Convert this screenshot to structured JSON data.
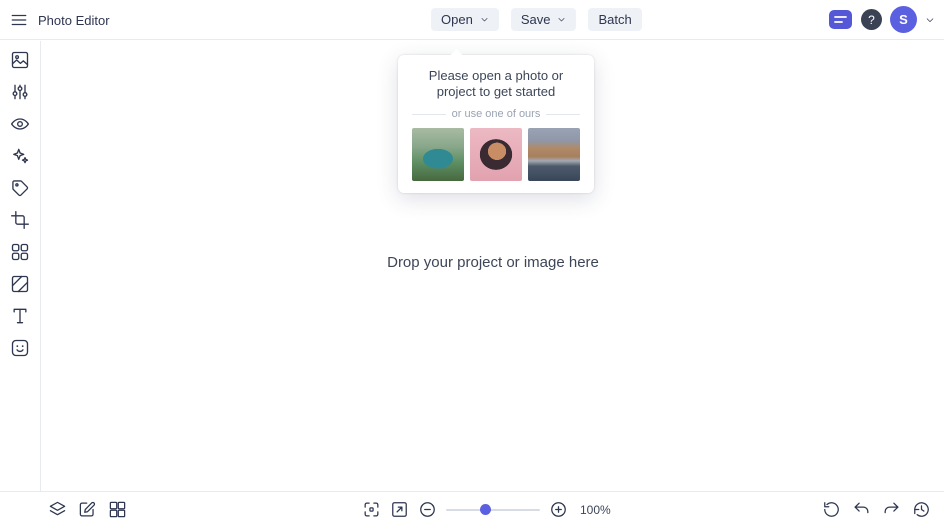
{
  "topbar": {
    "title": "Photo Editor",
    "open_label": "Open",
    "save_label": "Save",
    "batch_label": "Batch",
    "help_glyph": "?",
    "avatar_initial": "S"
  },
  "sidebar": {
    "tools": [
      "photo",
      "adjustments",
      "eye",
      "effects",
      "tag",
      "crop",
      "shapes",
      "overlay",
      "text",
      "sticker"
    ]
  },
  "popover": {
    "message": "Please open a photo or project to get started",
    "divider": "or use one of ours",
    "samples": [
      "van-sample",
      "portrait-sample",
      "canal-sample"
    ]
  },
  "canvas": {
    "drop_hint": "Drop your project or image here"
  },
  "bottombar": {
    "left_tools": [
      "layers",
      "edit-image",
      "collage-grid"
    ],
    "center_tools": [
      "fit-screen",
      "actual-size",
      "zoom-out",
      "zoom-slider",
      "zoom-in"
    ],
    "right_tools": [
      "reset",
      "undo",
      "redo",
      "history"
    ],
    "zoom": "100%",
    "slider_position": 0.42
  },
  "colors": {
    "accent": "#5b60e0",
    "icon": "#2e3650",
    "button_bg": "#eef1f6",
    "help_bg": "#3a4254"
  }
}
